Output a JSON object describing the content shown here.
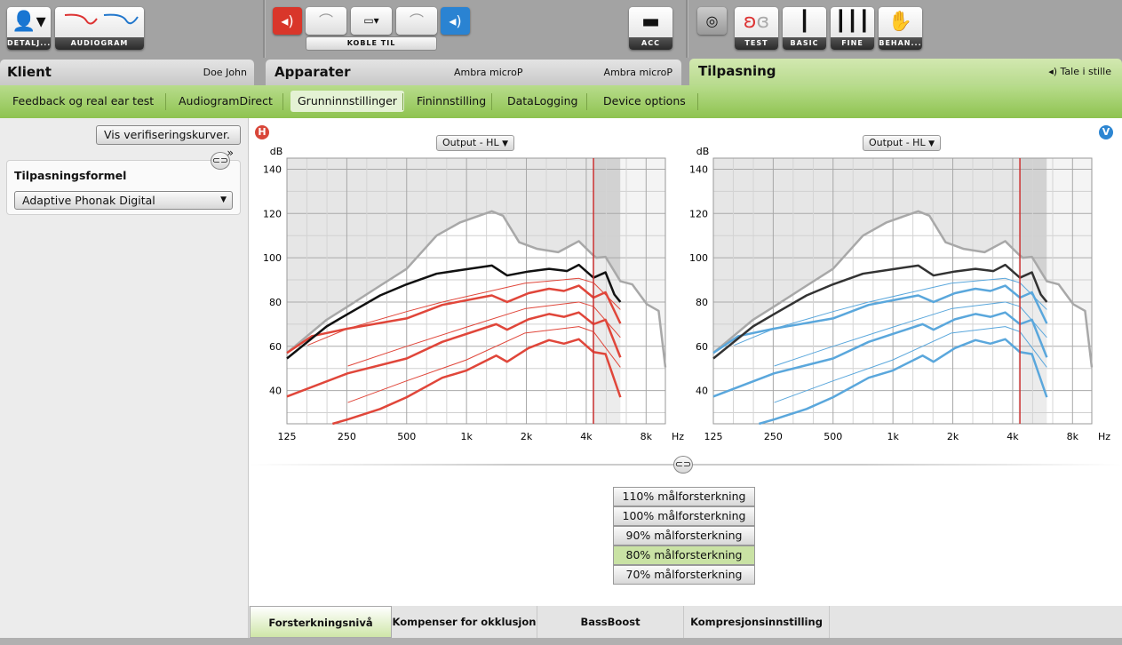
{
  "toolbar": {
    "details_label": "DETALJ...",
    "audiogram_label": "AUDIOGRAM",
    "connect_label": "KOBLE TIL",
    "acc_label": "ACC",
    "test_label": "TEST",
    "basic_label": "BASIC",
    "fine_label": "FINE",
    "behan_label": "BEHAN...",
    "icons": [
      "user-icon",
      "audiogram-icon",
      "mute-left-icon",
      "hearing-aid-left-icon",
      "programmer-icon",
      "hearing-aid-right-icon",
      "speaker-right-icon",
      "remote-icon",
      "target-icon",
      "ear-icon",
      "slider-icon",
      "sliders-icon",
      "hand-icon"
    ]
  },
  "headers": {
    "client": {
      "title": "Klient",
      "value": "Doe John"
    },
    "devices": {
      "title": "Apparater",
      "left": "Ambra microP",
      "right": "Ambra microP"
    },
    "fitting": {
      "title": "Tilpasning",
      "program": "Tale i stille"
    }
  },
  "subtabs": [
    {
      "label": "Feedback og real ear test"
    },
    {
      "label": "AudiogramDirect"
    },
    {
      "label": "Grunninnstillinger",
      "active": true
    },
    {
      "label": "Fininnstilling"
    },
    {
      "label": "DataLogging"
    },
    {
      "label": "Device options"
    }
  ],
  "left_panel": {
    "verify_button": "Vis verifiseringskurver.",
    "verify_chevron": "»",
    "formula_title": "Tilpasningsformel",
    "formula_value": "Adaptive Phonak Digital"
  },
  "charts_header": {
    "right_badge": "H",
    "left_badge": "V",
    "view_select": "Output - HL"
  },
  "levels": [
    {
      "label": "110% målforsterkning"
    },
    {
      "label": "100% målforsterkning"
    },
    {
      "label": "90% målforsterkning"
    },
    {
      "label": "80% målforsterkning",
      "selected": true
    },
    {
      "label": "70% målforsterkning"
    }
  ],
  "bottom_tabs": [
    {
      "label": "Forsterkningsnivå",
      "active": true
    },
    {
      "label": "Kompenser for okklusjon"
    },
    {
      "label": "BassBoost"
    },
    {
      "label": "Kompresjonsinnstilling"
    }
  ],
  "chart_data": [
    {
      "type": "line",
      "side": "right",
      "color": "#e0463a",
      "ylabel": "dB",
      "xunit": "Hz",
      "xticks": [
        {
          "v": 125,
          "l": "125"
        },
        {
          "v": 250,
          "l": "250"
        },
        {
          "v": 500,
          "l": "500"
        },
        {
          "v": 1000,
          "l": "1k"
        },
        {
          "v": 2000,
          "l": "2k"
        },
        {
          "v": 4000,
          "l": "4k"
        },
        {
          "v": 8000,
          "l": "8k"
        }
      ],
      "yticks": [
        40,
        60,
        80,
        100,
        120,
        140
      ],
      "xlim": [
        125,
        10000
      ],
      "ylim": [
        25,
        145
      ],
      "x_scale": "log",
      "grid": true,
      "marker_freq": 4350,
      "mpo": [
        [
          125,
          57
        ],
        [
          198,
          72
        ],
        [
          253,
          78
        ],
        [
          348,
          86
        ],
        [
          500,
          95
        ],
        [
          707,
          110
        ],
        [
          930,
          116
        ],
        [
          1340,
          121
        ],
        [
          1525,
          119
        ],
        [
          1840,
          107
        ],
        [
          2270,
          104
        ],
        [
          2890,
          102.5
        ],
        [
          3670,
          107.5
        ],
        [
          4290,
          101.5
        ],
        [
          4500,
          100
        ],
        [
          5000,
          100.4
        ],
        [
          5940,
          89.4
        ],
        [
          6810,
          88
        ],
        [
          8070,
          79
        ],
        [
          9250,
          76
        ],
        [
          10000,
          50.5
        ]
      ],
      "max_curve": [
        [
          125,
          54.5
        ],
        [
          198,
          69
        ],
        [
          253,
          74.6
        ],
        [
          368,
          83
        ],
        [
          500,
          88
        ],
        [
          707,
          92.8
        ],
        [
          994,
          94.8
        ],
        [
          1340,
          96.5
        ],
        [
          1600,
          92
        ],
        [
          2050,
          93.8
        ],
        [
          2600,
          95
        ],
        [
          3200,
          94
        ],
        [
          3670,
          96.8
        ],
        [
          4350,
          91
        ],
        [
          5000,
          93.4
        ],
        [
          5540,
          83.4
        ],
        [
          5940,
          80
        ]
      ],
      "loud": [
        [
          125,
          57
        ],
        [
          167,
          64.6
        ],
        [
          253,
          68
        ],
        [
          500,
          72.6
        ],
        [
          755,
          78.7
        ],
        [
          1340,
          83
        ],
        [
          1600,
          80
        ],
        [
          2050,
          84
        ],
        [
          2600,
          86
        ],
        [
          3090,
          85
        ],
        [
          3670,
          87.4
        ],
        [
          4350,
          82
        ],
        [
          5000,
          84.4
        ],
        [
          5940,
          70.3
        ]
      ],
      "medium": [
        [
          125,
          37.3
        ],
        [
          253,
          47.8
        ],
        [
          500,
          54.5
        ],
        [
          755,
          62
        ],
        [
          1410,
          70
        ],
        [
          1600,
          67.5
        ],
        [
          2050,
          72.2
        ],
        [
          2600,
          74.6
        ],
        [
          3090,
          73.3
        ],
        [
          3670,
          75.3
        ],
        [
          4350,
          70
        ],
        [
          5000,
          72
        ],
        [
          5940,
          55
        ]
      ],
      "soft": [
        [
          212,
          25
        ],
        [
          253,
          27
        ],
        [
          368,
          31.7
        ],
        [
          500,
          37
        ],
        [
          755,
          45.8
        ],
        [
          994,
          49
        ],
        [
          1410,
          55.8
        ],
        [
          1600,
          53
        ],
        [
          2050,
          59.2
        ],
        [
          2600,
          62.8
        ],
        [
          3090,
          61.2
        ],
        [
          3670,
          63.2
        ],
        [
          4350,
          57.4
        ],
        [
          5000,
          56.5
        ],
        [
          5940,
          37
        ]
      ],
      "target_loud": [
        [
          159,
          60.5
        ],
        [
          253,
          68
        ],
        [
          500,
          75.7
        ],
        [
          755,
          80
        ],
        [
          1970,
          88.5
        ],
        [
          3670,
          90.7
        ],
        [
          4350,
          88.7
        ],
        [
          5940,
          76.6
        ]
      ],
      "target_medium": [
        [
          253,
          51.1
        ],
        [
          500,
          60
        ],
        [
          994,
          68.6
        ],
        [
          1970,
          77
        ],
        [
          3670,
          80
        ],
        [
          4350,
          78
        ],
        [
          5940,
          64
        ]
      ],
      "target_soft": [
        [
          253,
          34.6
        ],
        [
          500,
          44.4
        ],
        [
          994,
          53.8
        ],
        [
          1970,
          66
        ],
        [
          3670,
          68.9
        ],
        [
          4350,
          66.6
        ],
        [
          5940,
          50.5
        ]
      ]
    },
    {
      "type": "line",
      "side": "left",
      "color": "#5aa7dc",
      "ylabel": "dB",
      "xunit": "Hz",
      "xticks": [
        {
          "v": 125,
          "l": "125"
        },
        {
          "v": 250,
          "l": "250"
        },
        {
          "v": 500,
          "l": "500"
        },
        {
          "v": 1000,
          "l": "1k"
        },
        {
          "v": 2000,
          "l": "2k"
        },
        {
          "v": 4000,
          "l": "4k"
        },
        {
          "v": 8000,
          "l": "8k"
        }
      ],
      "yticks": [
        40,
        60,
        80,
        100,
        120,
        140
      ],
      "xlim": [
        125,
        10000
      ],
      "ylim": [
        25,
        145
      ],
      "x_scale": "log",
      "grid": true,
      "marker_freq": 4350,
      "mpo": [
        [
          125,
          57
        ],
        [
          198,
          72
        ],
        [
          253,
          78
        ],
        [
          348,
          86
        ],
        [
          500,
          95
        ],
        [
          707,
          110
        ],
        [
          930,
          116
        ],
        [
          1340,
          121
        ],
        [
          1525,
          119
        ],
        [
          1840,
          107
        ],
        [
          2270,
          104
        ],
        [
          2890,
          102.5
        ],
        [
          3670,
          107.5
        ],
        [
          4290,
          101.5
        ],
        [
          4500,
          100
        ],
        [
          5000,
          100.4
        ],
        [
          5940,
          89.4
        ],
        [
          6810,
          88
        ],
        [
          8070,
          79
        ],
        [
          9250,
          76
        ],
        [
          10000,
          50.5
        ]
      ],
      "max_curve": [
        [
          125,
          54.5
        ],
        [
          198,
          69
        ],
        [
          253,
          74.6
        ],
        [
          368,
          83
        ],
        [
          500,
          88
        ],
        [
          707,
          92.8
        ],
        [
          994,
          94.8
        ],
        [
          1340,
          96.5
        ],
        [
          1600,
          92
        ],
        [
          2050,
          93.8
        ],
        [
          2600,
          95
        ],
        [
          3200,
          94
        ],
        [
          3670,
          96.8
        ],
        [
          4350,
          91
        ],
        [
          5000,
          93.4
        ],
        [
          5540,
          83.4
        ],
        [
          5940,
          80
        ]
      ],
      "loud": [
        [
          125,
          57
        ],
        [
          167,
          64.6
        ],
        [
          253,
          68
        ],
        [
          500,
          72.6
        ],
        [
          755,
          78.7
        ],
        [
          1340,
          83
        ],
        [
          1600,
          80
        ],
        [
          2050,
          84
        ],
        [
          2600,
          86
        ],
        [
          3090,
          85
        ],
        [
          3670,
          87.4
        ],
        [
          4350,
          82
        ],
        [
          5000,
          84.4
        ],
        [
          5940,
          70.3
        ]
      ],
      "medium": [
        [
          125,
          37.3
        ],
        [
          253,
          47.8
        ],
        [
          500,
          54.5
        ],
        [
          755,
          62
        ],
        [
          1410,
          70
        ],
        [
          1600,
          67.5
        ],
        [
          2050,
          72.2
        ],
        [
          2600,
          74.6
        ],
        [
          3090,
          73.3
        ],
        [
          3670,
          75.3
        ],
        [
          4350,
          70
        ],
        [
          5000,
          72
        ],
        [
          5940,
          55
        ]
      ],
      "soft": [
        [
          212,
          25
        ],
        [
          253,
          27
        ],
        [
          368,
          31.7
        ],
        [
          500,
          37
        ],
        [
          755,
          45.8
        ],
        [
          994,
          49
        ],
        [
          1410,
          55.8
        ],
        [
          1600,
          53
        ],
        [
          2050,
          59.2
        ],
        [
          2600,
          62.8
        ],
        [
          3090,
          61.2
        ],
        [
          3670,
          63.2
        ],
        [
          4350,
          57.4
        ],
        [
          5000,
          56.5
        ],
        [
          5940,
          37
        ]
      ],
      "target_loud": [
        [
          159,
          60.5
        ],
        [
          253,
          68
        ],
        [
          500,
          75.7
        ],
        [
          755,
          80
        ],
        [
          1970,
          88.5
        ],
        [
          3670,
          90.7
        ],
        [
          4350,
          88.7
        ],
        [
          5940,
          76.6
        ]
      ],
      "target_medium": [
        [
          253,
          51.1
        ],
        [
          500,
          60
        ],
        [
          994,
          68.6
        ],
        [
          1970,
          77
        ],
        [
          3670,
          80
        ],
        [
          4350,
          78
        ],
        [
          5940,
          64
        ]
      ],
      "target_soft": [
        [
          253,
          34.6
        ],
        [
          500,
          44.4
        ],
        [
          994,
          53.8
        ],
        [
          1970,
          66
        ],
        [
          3670,
          68.9
        ],
        [
          4350,
          66.6
        ],
        [
          5940,
          50.5
        ]
      ]
    }
  ]
}
